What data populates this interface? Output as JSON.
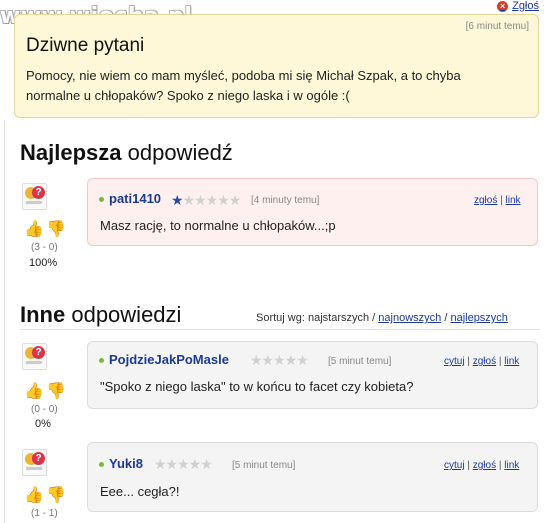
{
  "watermark": "www.wiocha.pl",
  "report_link": "Zgłoś",
  "question": {
    "time": "[6 minut temu]",
    "title": "Dziwne pytani",
    "text": "Pomocy, nie wiem co mam myśleć, podoba mi się Michał Szpak, a to chyba normalne u chłopaków? Spoko z niego laska i w ogóle :("
  },
  "best_heading": {
    "bold": "Najlepsza",
    "rest": " odpowiedź"
  },
  "others_heading": {
    "bold": "Inne",
    "rest": " odpowiedzi"
  },
  "sort": {
    "label": "Sortuj wg: najstarszych /",
    "newest": "najnowszych",
    "slash": "/",
    "best": "najlepszych"
  },
  "answers": [
    {
      "user": "pati1410",
      "stars_filled": 1,
      "stars_total": 6,
      "time": "[4 minuty temu]",
      "links": {
        "cytuj": "",
        "zglos": "zgłoś",
        "link": "link"
      },
      "text": "Masz rację, to normalne u chłopaków...;p",
      "votes": "(3 - 0)",
      "percent": "100%"
    },
    {
      "user": "PojdzieJakPoMasle",
      "stars_filled": 0,
      "stars_total": 5,
      "time": "[5 minut temu]",
      "links": {
        "cytuj": "cytuj",
        "zglos": "zgłoś",
        "link": "link"
      },
      "text": "\"Spoko z niego laska\" to w końcu to facet czy kobieta?",
      "votes": "(0 - 0)",
      "percent": "0%"
    },
    {
      "user": "Yuki8",
      "stars_filled": 0,
      "stars_total": 5,
      "time": "[5 minut temu]",
      "links": {
        "cytuj": "cytuj",
        "zglos": "zgłoś",
        "link": "link"
      },
      "text": "Eee... cegła?!",
      "votes": "(1 - 1)",
      "percent": ""
    }
  ],
  "link_sep": "|",
  "colors": {
    "question_bg": "#fff8d8",
    "best_bg": "#fff0f0",
    "link": "#1a3a99",
    "thumb_up": "#c7449a",
    "thumb_down": "#d6a91e"
  },
  "icons": {
    "report": "close-circle-icon",
    "avatar": "sam-avatar-icon",
    "thumb_up": "thumb-up-icon",
    "thumb_down": "thumb-down-icon",
    "online": "online-dot-icon",
    "star": "star-icon"
  }
}
